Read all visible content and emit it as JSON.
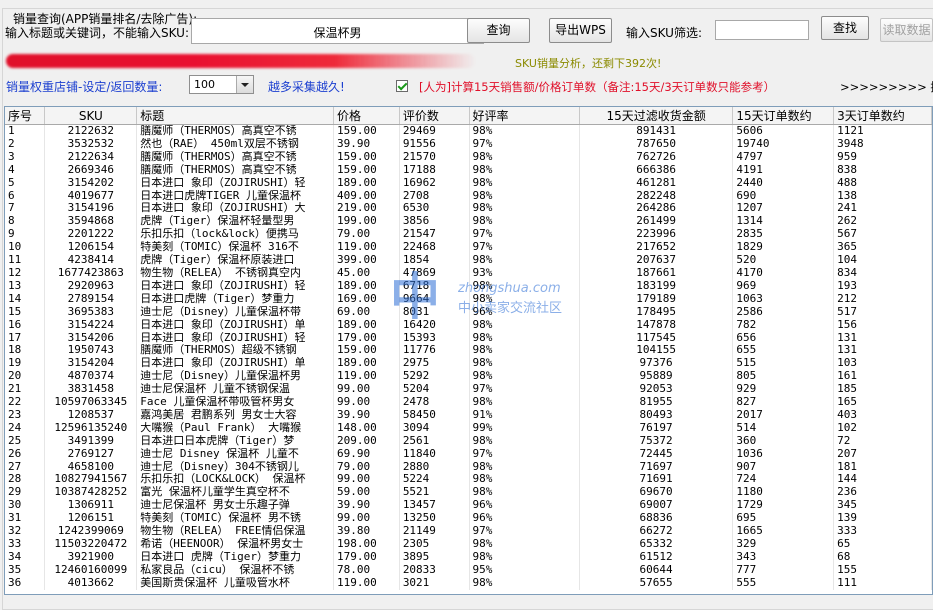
{
  "group_title": "销量查询(APP销量排名/去除广告):",
  "search": {
    "label": "输入标题或关键词，不能输入SKU:",
    "value": "保温杯男",
    "query_button": "查询",
    "export_button": "导出WPS",
    "sku_filter_label": "输入SKU筛选:",
    "sku_filter_value": "",
    "find_button": "查找",
    "read_button": "读取数据"
  },
  "notice": "SKU销量分析，还剩下392次!",
  "weight": {
    "label": "销量权重店铺-设定/返回数量:",
    "value": "100",
    "more_hint": "越多采集越久!",
    "calc_checkbox_label": "[人为]计算15天销售额/价格订单数（备注:15天/3天订单数只能参考）",
    "calc_checked": true,
    "arrow_hint": ">>>>>>>>> 提示:"
  },
  "watermark": {
    "big": "中",
    "url": "zhongshua.com",
    "tag": "中小卖家交流社区"
  },
  "colors": {
    "accent_blue": "#1c3fd0",
    "warn_red": "#e0102a",
    "notice_olive": "#8b8b00"
  },
  "table": {
    "columns": [
      "序号",
      "SKU",
      "标题",
      "价格",
      "评价数",
      "好评率",
      "15天过滤收货金额",
      "15天订单数约",
      "3天订单数约"
    ],
    "rows": [
      [
        "1",
        "2122632",
        "膳魔师（THERMOS）高真空不锈",
        "159.00",
        "29469",
        "98%",
        "891431",
        "5606",
        "1121"
      ],
      [
        "2",
        "3532532",
        "然也（RAE） 450ml双层不锈钢",
        "39.90",
        "91556",
        "97%",
        "787650",
        "19740",
        "3948"
      ],
      [
        "3",
        "2122634",
        "膳魔师（THERMOS）高真空不锈",
        "159.00",
        "21570",
        "98%",
        "762726",
        "4797",
        "959"
      ],
      [
        "4",
        "2669346",
        "膳魔师（THERMOS）高真空不锈",
        "159.00",
        "17188",
        "98%",
        "666386",
        "4191",
        "838"
      ],
      [
        "5",
        "3154202",
        "日本进口 象印（ZOJIRUSHI）轻",
        "189.00",
        "16962",
        "98%",
        "461281",
        "2440",
        "488"
      ],
      [
        "6",
        "4019677",
        "日本进口虎牌TIGER 儿童保温杯",
        "409.00",
        "2708",
        "98%",
        "282248",
        "690",
        "138"
      ],
      [
        "7",
        "3154196",
        "日本进口 象印（ZOJIRUSHI）大",
        "219.00",
        "6530",
        "98%",
        "264286",
        "1207",
        "241"
      ],
      [
        "8",
        "3594868",
        "虎牌（Tiger）保温杯轻量型男",
        "199.00",
        "3856",
        "98%",
        "261499",
        "1314",
        "262"
      ],
      [
        "9",
        "2201222",
        "乐扣乐扣（lock&lock）便携马",
        "79.00",
        "21547",
        "97%",
        "223996",
        "2835",
        "567"
      ],
      [
        "10",
        "1206154",
        "特美刻（TOMIC）保温杯 316不",
        "119.00",
        "22468",
        "97%",
        "217652",
        "1829",
        "365"
      ],
      [
        "11",
        "4238414",
        "虎牌（Tiger）保温杯原装进口",
        "399.00",
        "1854",
        "98%",
        "207637",
        "520",
        "104"
      ],
      [
        "12",
        "1677423863",
        "物生物（RELEA） 不锈钢真空内",
        "45.00",
        "47869",
        "93%",
        "187661",
        "4170",
        "834"
      ],
      [
        "13",
        "2920963",
        "日本进口 象印（ZOJIRUSHI）轻",
        "189.00",
        "6718",
        "98%",
        "183199",
        "969",
        "193"
      ],
      [
        "14",
        "2789154",
        "日本进口虎牌（Tiger）梦重力",
        "169.00",
        "9664",
        "98%",
        "179189",
        "1063",
        "212"
      ],
      [
        "15",
        "3695383",
        "迪士尼（Disney）儿童保温杯带",
        "69.00",
        "8031",
        "96%",
        "178495",
        "2586",
        "517"
      ],
      [
        "16",
        "3154224",
        "日本进口 象印（ZOJIRUSHI）单",
        "189.00",
        "16420",
        "98%",
        "147878",
        "782",
        "156"
      ],
      [
        "17",
        "3154206",
        "日本进口 象印（ZOJIRUSHI）轻",
        "179.00",
        "15393",
        "98%",
        "117545",
        "656",
        "131"
      ],
      [
        "18",
        "1950743",
        "膳魔师（THERMOS）超级不锈钢",
        "159.00",
        "11776",
        "98%",
        "104155",
        "655",
        "131"
      ],
      [
        "19",
        "3154204",
        "日本进口 象印（ZOJIRUSHI）单",
        "189.00",
        "2975",
        "98%",
        "97376",
        "515",
        "103"
      ],
      [
        "20",
        "4870374",
        "迪士尼（Disney）儿童保温杯男",
        "119.00",
        "5292",
        "98%",
        "95889",
        "805",
        "161"
      ],
      [
        "21",
        "3831458",
        "迪士尼保温杯 儿童不锈钢保温",
        "99.00",
        "5204",
        "97%",
        "92053",
        "929",
        "185"
      ],
      [
        "22",
        "10597063345",
        "Face 儿童保温杯带吸管杯男女",
        "99.00",
        "2478",
        "98%",
        "81955",
        "827",
        "165"
      ],
      [
        "23",
        "1208537",
        "嘉鸿美居 君鹏系列 男女士大容",
        "39.90",
        "58450",
        "91%",
        "80493",
        "2017",
        "403"
      ],
      [
        "24",
        "12596135240",
        "大嘴猴（Paul Frank） 大嘴猴",
        "148.00",
        "3094",
        "99%",
        "76197",
        "514",
        "102"
      ],
      [
        "25",
        "3491399",
        "日本进口日本虎牌（Tiger）梦",
        "209.00",
        "2561",
        "98%",
        "75372",
        "360",
        "72"
      ],
      [
        "26",
        "2769127",
        "迪士尼 Disney 保温杯 儿童不",
        "69.90",
        "11840",
        "97%",
        "72445",
        "1036",
        "207"
      ],
      [
        "27",
        "4658100",
        "迪士尼（Disney）304不锈钢儿",
        "79.00",
        "2880",
        "98%",
        "71697",
        "907",
        "181"
      ],
      [
        "28",
        "10827941567",
        "乐扣乐扣（LOCK&LOCK） 保温杯",
        "99.00",
        "5224",
        "98%",
        "71691",
        "724",
        "144"
      ],
      [
        "29",
        "10387428252",
        "富光 保温杯儿童学生真空杯不",
        "59.00",
        "5521",
        "98%",
        "69670",
        "1180",
        "236"
      ],
      [
        "30",
        "1306911",
        "迪士尼保温杯 男女士乐趣子弹",
        "39.90",
        "13457",
        "96%",
        "69007",
        "1729",
        "345"
      ],
      [
        "31",
        "1206151",
        "特美刻（TOMIC）保温杯 男不锈",
        "99.00",
        "13250",
        "96%",
        "68836",
        "695",
        "139"
      ],
      [
        "32",
        "1242399069",
        "物生物（RELEA） FREE情侣保温",
        "39.80",
        "21149",
        "97%",
        "66272",
        "1665",
        "333"
      ],
      [
        "33",
        "11503220472",
        "希诺（HEENOOR） 保温杯男女士",
        "198.00",
        "2305",
        "98%",
        "65332",
        "329",
        "65"
      ],
      [
        "34",
        "3921900",
        "日本进口 虎牌（Tiger）梦重力",
        "179.00",
        "3895",
        "98%",
        "61512",
        "343",
        "68"
      ],
      [
        "35",
        "12460160099",
        "私家良品（cicu） 保温杯不锈",
        "78.00",
        "20833",
        "95%",
        "60644",
        "777",
        "155"
      ],
      [
        "36",
        "4013662",
        "美国斯贵保温杯 儿童吸管水杯",
        "119.00",
        "3021",
        "98%",
        "57655",
        "555",
        "111"
      ]
    ]
  }
}
